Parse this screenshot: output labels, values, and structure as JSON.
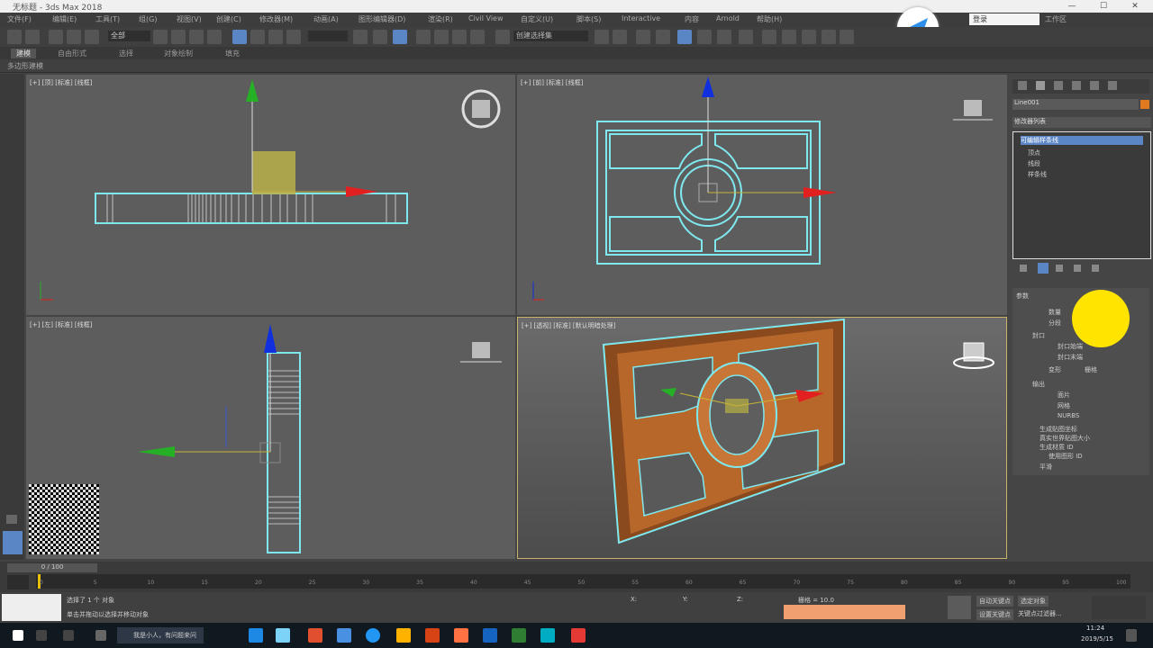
{
  "window": {
    "title": "无标题 - 3ds Max 2018",
    "controls": [
      "—",
      "☐",
      "✕"
    ]
  },
  "menu": {
    "items": [
      "文件(F)",
      "编辑(E)",
      "工具(T)",
      "组(G)",
      "视图(V)",
      "创建(C)",
      "修改器(M)",
      "动画(A)",
      "图形编辑器(D)",
      "渲染(R)",
      "Civil View",
      "自定义(U)",
      "脚本(S)",
      "Interactive",
      "内容",
      "Arnold",
      "帮助(H)"
    ],
    "signin_label": "登录",
    "workspace_label": "工作区"
  },
  "toolbar": {
    "selection_filter": "全部",
    "named_selection": "创建选择集"
  },
  "ribbon": {
    "tabs": [
      "建模",
      "自由形式",
      "选择",
      "对象绘制",
      "填充"
    ],
    "subpanel": "多边形建模"
  },
  "viewports": {
    "top_left": "[+] [顶] [标准] [线框]",
    "top_right": "[+] [前] [标准] [线框]",
    "bottom_left": "[+] [左] [标准] [线框]",
    "bottom_right": "[+] [透视] [标准] [默认明暗处理]"
  },
  "command_panel": {
    "object_name": "Line001",
    "modifier_list": "修改器列表",
    "stack": [
      "可编辑样条线",
      "顶点",
      "线段",
      "样条线"
    ],
    "rollout_title": "参数",
    "param_amount": "数量",
    "param_segments": "分段",
    "capping_label": "封口",
    "cap_start": "封口始端",
    "cap_end": "封口末端",
    "morph": "变形",
    "grid": "栅格",
    "output_label": "输出",
    "output_patch": "面片",
    "output_mesh": "网格",
    "output_nurbs": "NURBS",
    "gen_mapping": "生成贴图坐标",
    "real_world": "真实世界贴图大小",
    "gen_material": "生成材质 ID",
    "use_shape": "使用图形 ID",
    "smooth": "平滑"
  },
  "timeline": {
    "frame_label": "0 / 100",
    "ticks": [
      "0",
      "5",
      "10",
      "15",
      "20",
      "25",
      "30",
      "35",
      "40",
      "45",
      "50",
      "55",
      "60",
      "65",
      "70",
      "75",
      "80",
      "85",
      "90",
      "95",
      "100"
    ]
  },
  "status": {
    "selected": "选择了 1 个 对象",
    "prompt": "单击并拖动以选择并移动对象",
    "x_val": "X:",
    "y_val": "Y:",
    "z_val": "Z:",
    "grid_label": "栅格 = 10.0",
    "autokey": "自动关键点",
    "setkey": "设置关键点",
    "selected_obj": "选定对象",
    "key_filters": "关键点过滤器..."
  },
  "taskbar": {
    "search_placeholder": "我是小人，有问题来问",
    "time": "11:24",
    "date": "2019/5/15"
  },
  "colors": {
    "wire": "#7fe8ee",
    "wood": "#b8672b",
    "x_axis": "#e32020",
    "y_axis": "#25b025",
    "z_axis": "#1030e0",
    "highlight": "#ffe400"
  }
}
